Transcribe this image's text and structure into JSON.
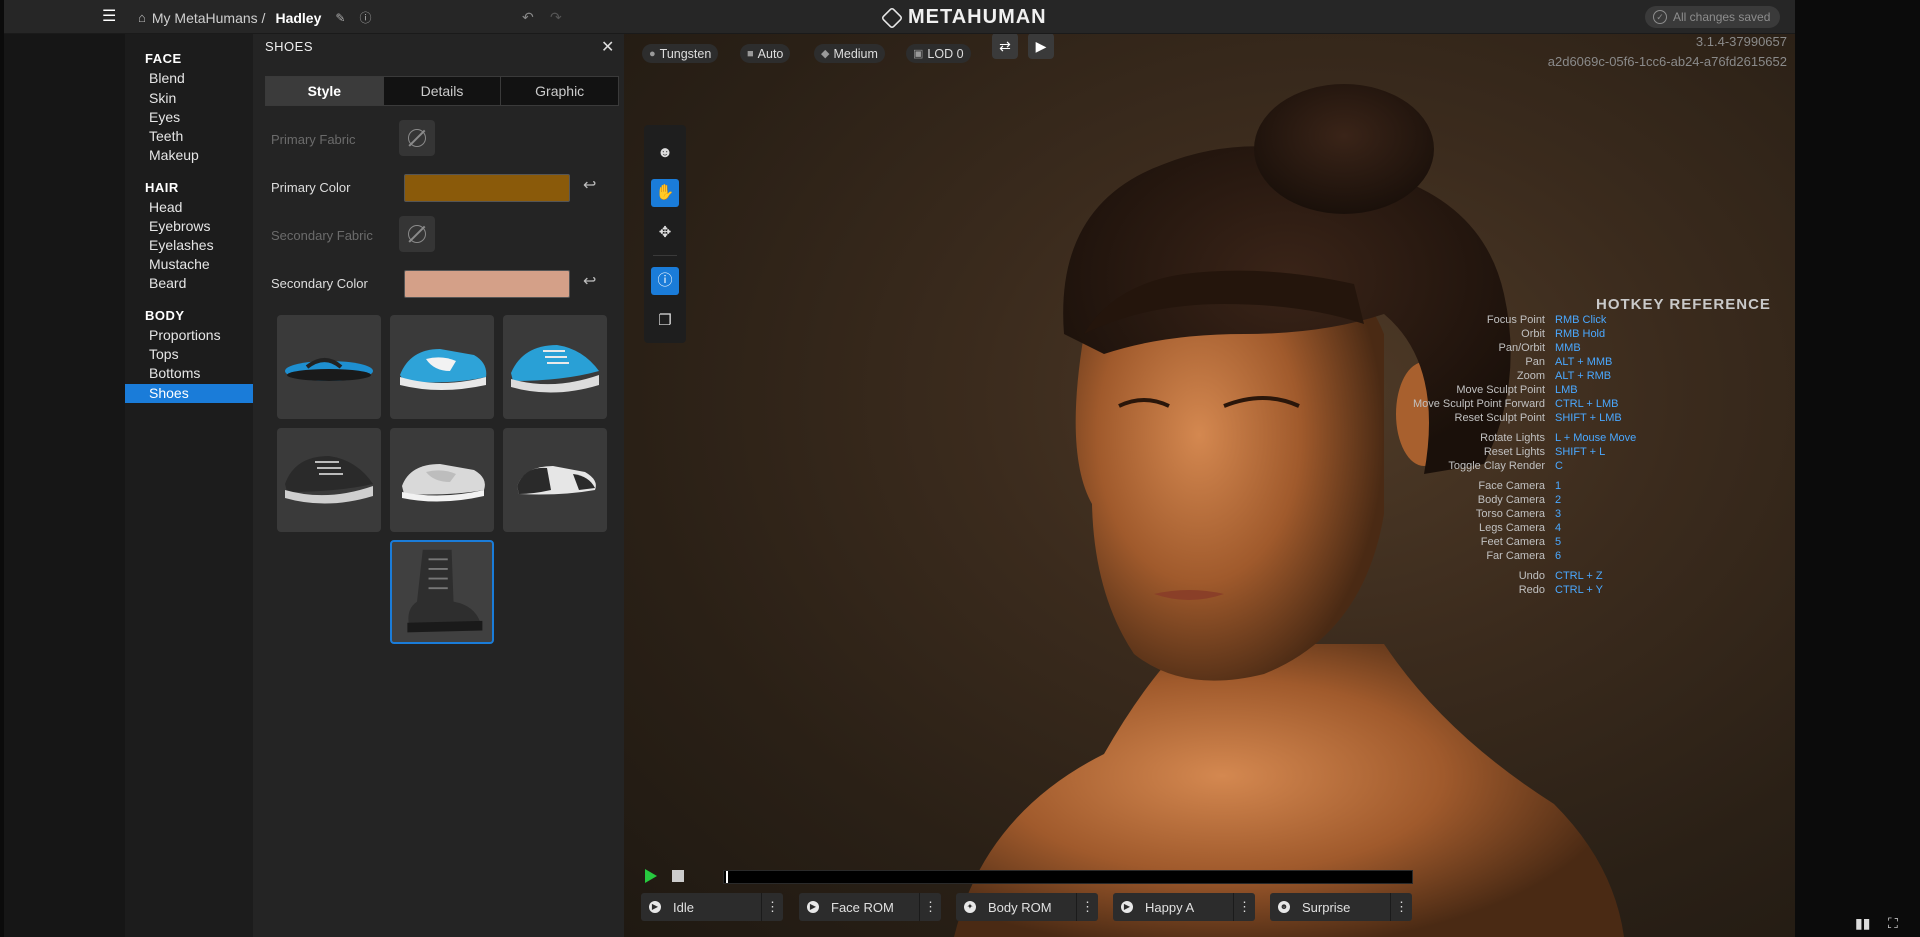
{
  "header": {
    "breadcrumb_root": "My MetaHumans /",
    "character_name": "Hadley",
    "logo_text": "METAHUMAN",
    "save_status": "All changes saved"
  },
  "categories": {
    "face": {
      "title": "FACE",
      "items": [
        "Blend",
        "Skin",
        "Eyes",
        "Teeth",
        "Makeup"
      ]
    },
    "hair": {
      "title": "HAIR",
      "items": [
        "Head",
        "Eyebrows",
        "Eyelashes",
        "Mustache",
        "Beard"
      ]
    },
    "body": {
      "title": "BODY",
      "items": [
        "Proportions",
        "Tops",
        "Bottoms",
        "Shoes"
      ],
      "active": "Shoes"
    }
  },
  "shoes_panel": {
    "title": "SHOES",
    "tabs": [
      "Style",
      "Details",
      "Graphic"
    ],
    "active_tab": "Style",
    "primary_fabric_label": "Primary Fabric",
    "primary_color_label": "Primary Color",
    "primary_color": "#8a5a0a",
    "secondary_fabric_label": "Secondary Fabric",
    "secondary_color_label": "Secondary Color",
    "secondary_color": "#d4a088",
    "shoe_options": [
      "flip-flop",
      "slip-on-blue",
      "sneaker-blue",
      "sneaker-black",
      "slip-on-white",
      "oxford-two-tone",
      "combat-boot"
    ],
    "selected_shoe": "combat-boot"
  },
  "viewport": {
    "chips": [
      {
        "icon": "bulb-icon",
        "label": "Tungsten"
      },
      {
        "icon": "camera-icon",
        "label": "Auto"
      },
      {
        "icon": "quality-icon",
        "label": "Medium"
      },
      {
        "icon": "cube-icon",
        "label": "LOD 0"
      }
    ],
    "version": "3.1.4-37990657",
    "guid": "a2d6069c-05f6-1cc6-ab24-a76fd2615652"
  },
  "hotkeys": {
    "title": "HOTKEY REFERENCE",
    "rows": [
      {
        "action": "Focus Point",
        "key": "RMB Click"
      },
      {
        "action": "Orbit",
        "key": "RMB Hold"
      },
      {
        "action": "Pan/Orbit",
        "key": "MMB"
      },
      {
        "action": "Pan",
        "key": "ALT + MMB"
      },
      {
        "action": "Zoom",
        "key": "ALT + RMB"
      },
      {
        "action": "Move Sculpt Point",
        "key": "LMB"
      },
      {
        "action": "Move Sculpt Point Forward",
        "key": "CTRL + LMB"
      },
      {
        "action": "Reset Sculpt Point",
        "key": "SHIFT + LMB"
      },
      {
        "action": "Rotate Lights",
        "key": "L + Mouse Move"
      },
      {
        "action": "Reset Lights",
        "key": "SHIFT + L"
      },
      {
        "action": "Toggle Clay Render",
        "key": "C"
      },
      {
        "action": "Face Camera",
        "key": "1"
      },
      {
        "action": "Body Camera",
        "key": "2"
      },
      {
        "action": "Torso Camera",
        "key": "3"
      },
      {
        "action": "Legs Camera",
        "key": "4"
      },
      {
        "action": "Feet Camera",
        "key": "5"
      },
      {
        "action": "Far Camera",
        "key": "6"
      },
      {
        "action": "Undo",
        "key": "CTRL + Z"
      },
      {
        "action": "Redo",
        "key": "CTRL + Y"
      }
    ]
  },
  "animations": [
    "Idle",
    "Face ROM",
    "Body ROM",
    "Happy A",
    "Surprise"
  ]
}
